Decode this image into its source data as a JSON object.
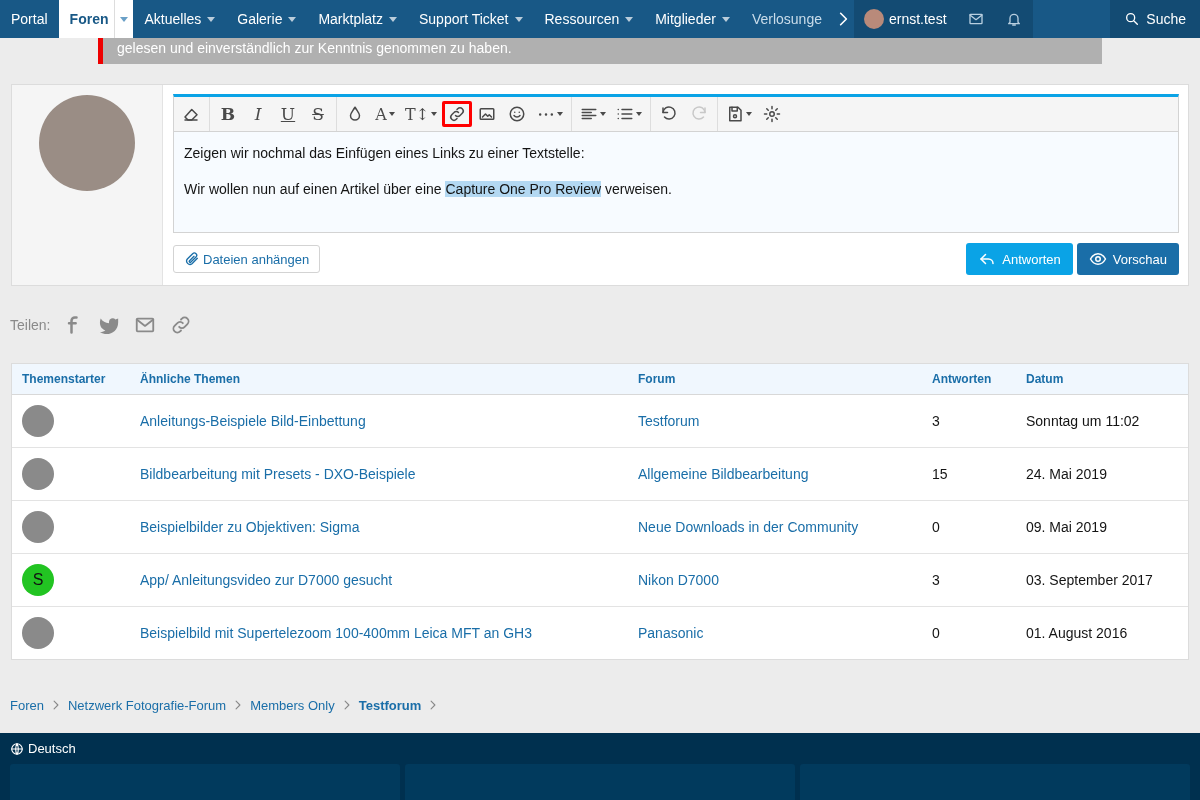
{
  "nav": {
    "items": [
      {
        "label": "Portal",
        "selected": false,
        "dropdown": false
      },
      {
        "label": "Foren",
        "selected": true,
        "dropdown": true
      },
      {
        "label": "Aktuelles",
        "selected": false,
        "dropdown": true
      },
      {
        "label": "Galerie",
        "selected": false,
        "dropdown": true
      },
      {
        "label": "Marktplatz",
        "selected": false,
        "dropdown": true
      },
      {
        "label": "Support Ticket",
        "selected": false,
        "dropdown": true
      },
      {
        "label": "Ressourcen",
        "selected": false,
        "dropdown": true
      },
      {
        "label": "Mitglieder",
        "selected": false,
        "dropdown": true
      },
      {
        "label": "Verlosunge",
        "selected": false,
        "dropdown": false
      }
    ],
    "user": "ernst.test",
    "search": "Suche"
  },
  "notice": "gelesen und einverständlich zur Kenntnis genommen zu haben.",
  "editor": {
    "toolbar": [
      {
        "kind": "eraser",
        "highlighted": false
      },
      {
        "kind": "bold",
        "glyph": "B",
        "highlighted": false
      },
      {
        "kind": "italic",
        "glyph": "I",
        "highlighted": false
      },
      {
        "kind": "underline",
        "glyph": "U",
        "highlighted": false
      },
      {
        "kind": "strike",
        "glyph": "S",
        "highlighted": false
      },
      {
        "kind": "color",
        "highlighted": false
      },
      {
        "kind": "font",
        "glyph": "A",
        "highlighted": false
      },
      {
        "kind": "size",
        "glyph": "T↕",
        "highlighted": false
      },
      {
        "kind": "link",
        "highlighted": true
      },
      {
        "kind": "image",
        "highlighted": false
      },
      {
        "kind": "smiley",
        "highlighted": false
      },
      {
        "kind": "more",
        "highlighted": false
      },
      {
        "kind": "align",
        "highlighted": false
      },
      {
        "kind": "list",
        "highlighted": false
      },
      {
        "kind": "undo",
        "highlighted": false,
        "disabled": false
      },
      {
        "kind": "redo",
        "highlighted": false,
        "disabled": true
      },
      {
        "kind": "save",
        "highlighted": false
      },
      {
        "kind": "gear",
        "highlighted": false
      }
    ],
    "line_1": "Zeigen wir nochmal das Einfügen eines Links zu einer Textstelle:",
    "line_2": {
      "before": "Wir wollen nun auf einen Artikel über eine ",
      "selected_text": "Capture One Pro Review",
      "after": " verweisen."
    },
    "attach_button": "Dateien anhängen",
    "reply_button": "Antworten",
    "preview_button": "Vorschau"
  },
  "share_label": "Teilen:",
  "table": {
    "columns": [
      "Themenstarter",
      "Ähnliche Themen",
      "Forum",
      "Antworten",
      "Datum"
    ],
    "rows": [
      {
        "avatar": {
          "kind": "photo"
        },
        "topic": "Anleitungs-Beispiele Bild-Einbettung",
        "forum": "Testforum",
        "replies": "3",
        "date": "Sonntag um 11:02"
      },
      {
        "avatar": {
          "kind": "photo"
        },
        "topic": "Bildbearbeitung mit Presets - DXO-Beispiele",
        "forum": "Allgemeine Bildbearbeitung",
        "replies": "15",
        "date": "24. Mai 2019"
      },
      {
        "avatar": {
          "kind": "photo"
        },
        "topic": "Beispielbilder zu Objektiven: Sigma",
        "forum": "Neue Downloads in der Community",
        "replies": "0",
        "date": "09. Mai 2019"
      },
      {
        "avatar": {
          "kind": "letter",
          "letter": "S",
          "color": "#22c422"
        },
        "topic": "App/ Anleitungsvideo zur D7000 gesucht",
        "forum": "Nikon D7000",
        "replies": "3",
        "date": "03. September 2017"
      },
      {
        "avatar": {
          "kind": "photo"
        },
        "topic": "Beispielbild mit Supertelezoom 100-400mm Leica MFT an GH3",
        "forum": "Panasonic",
        "replies": "0",
        "date": "01. August 2016"
      }
    ]
  },
  "breadcrumbs": [
    {
      "label": "Foren",
      "current": false
    },
    {
      "label": "Netzwerk Fotografie-Forum",
      "current": false
    },
    {
      "label": "Members Only",
      "current": false
    },
    {
      "label": "Testforum",
      "current": true
    }
  ],
  "footer": {
    "language": "Deutsch"
  }
}
